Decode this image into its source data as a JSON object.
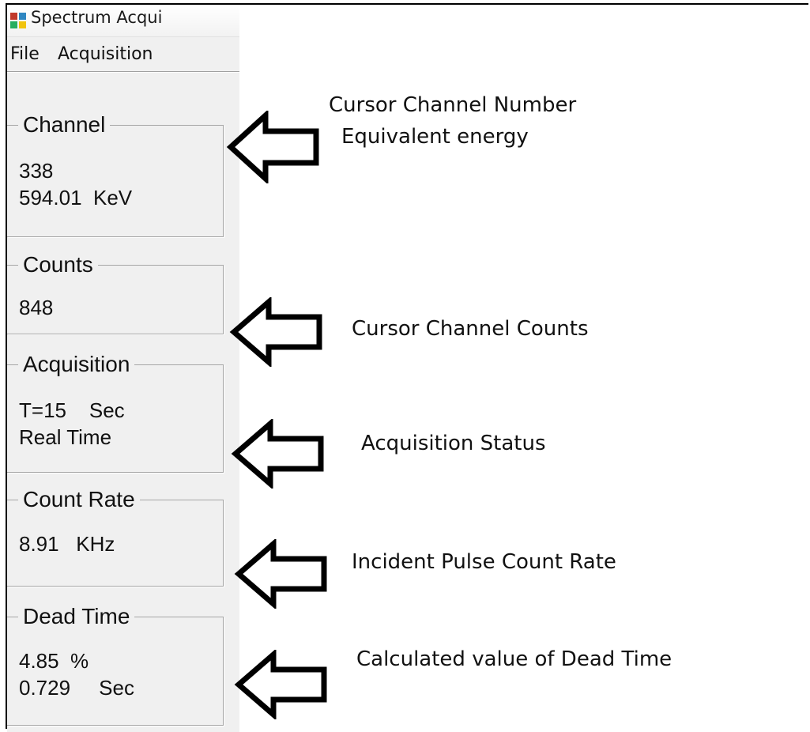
{
  "window": {
    "title": "Spectrum Acqui"
  },
  "menu": {
    "items": [
      "File",
      "Acquisition"
    ]
  },
  "panels": {
    "channel": {
      "legend": "Channel",
      "line1": "338",
      "line2": "594.01  KeV"
    },
    "counts": {
      "legend": "Counts",
      "line1": "848"
    },
    "acquisition": {
      "legend": "Acquisition",
      "line1": "T=15    Sec",
      "line2": "Real Time"
    },
    "count_rate": {
      "legend": "Count Rate",
      "line1": "8.91   KHz"
    },
    "dead_time": {
      "legend": "Dead Time",
      "line1": "4.85  %",
      "line2": "0.729     Sec"
    }
  },
  "annotations": {
    "channel_1": "Cursor Channel Number",
    "channel_2": "Equivalent energy",
    "counts": "Cursor Channel Counts",
    "acquisition": "Acquisition Status",
    "count_rate": "Incident Pulse Count Rate",
    "dead_time": "Calculated value of Dead Time"
  },
  "icons": {
    "app": "app-icon",
    "arrow": "left-arrow-icon"
  }
}
